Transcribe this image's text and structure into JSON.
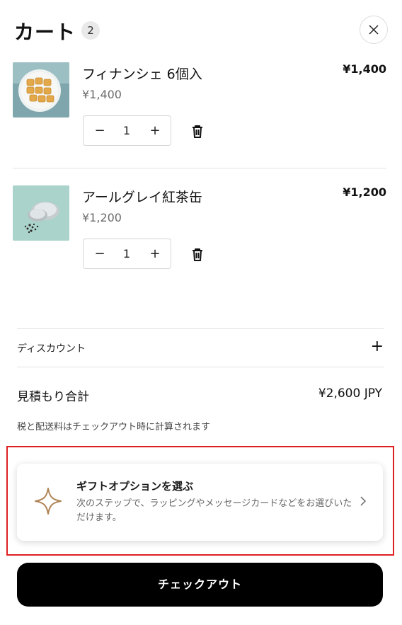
{
  "header": {
    "title": "カート",
    "item_count": "2"
  },
  "items": [
    {
      "name": "フィナンシェ 6個入",
      "unit_price": "¥1,400",
      "line_total": "¥1,400",
      "quantity": "1",
      "minus": "−",
      "plus": "+"
    },
    {
      "name": "アールグレイ紅茶缶",
      "unit_price": "¥1,200",
      "line_total": "¥1,200",
      "quantity": "1",
      "minus": "−",
      "plus": "+"
    }
  ],
  "discount": {
    "label": "ディスカウント",
    "toggle": "+"
  },
  "summary": {
    "subtotal_label": "見積もり合計",
    "subtotal_value": "¥2,600 JPY",
    "tax_note": "税と配送料はチェックアウト時に計算されます"
  },
  "gift": {
    "title": "ギフトオプションを選ぶ",
    "description": "次のステップで、ラッピングやメッセージカードなどをお選びいただけます。"
  },
  "checkout": {
    "label": "チェックアウト"
  },
  "icons": {
    "close": "close-icon",
    "trash": "trash-icon",
    "star": "sparkle-icon",
    "chevron": "chevron-right-icon"
  },
  "colors": {
    "highlight": "#e02020",
    "checkout_bg": "#000000",
    "star_accent": "#b08556"
  }
}
